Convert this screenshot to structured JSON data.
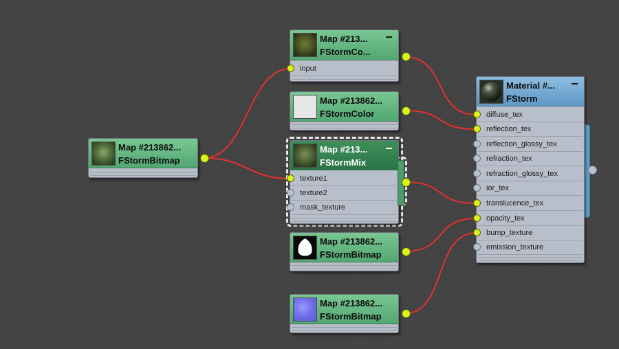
{
  "colors": {
    "canvas": "#434343",
    "wire": "#e53030",
    "connected_port": "#d9f21a",
    "free_port": "#b9c2d3",
    "map_header": "#5fb27e",
    "material_header": "#74a9d4"
  },
  "nodes": {
    "bitmap_source": {
      "line1": "Map #213862...",
      "line2": "FStormBitmap",
      "thumb": "leaf-texture"
    },
    "color_correct": {
      "line1": "Map #213...",
      "line2": "FStormCo...",
      "thumb": "leaf-texture-dark",
      "ports": [
        "input"
      ]
    },
    "fstorm_color": {
      "line1": "Map #213862...",
      "line2": "FStormColor",
      "thumb": "white-swatch"
    },
    "fstorm_mix": {
      "line1": "Map #213...",
      "line2": "FStormMix",
      "thumb": "leaf-texture",
      "ports": [
        "texture1",
        "texture2",
        "mask_texture"
      ]
    },
    "opacity_bitmap": {
      "line1": "Map #213862...",
      "line2": "FStormBitmap",
      "thumb": "leaf-mask"
    },
    "normal_bitmap": {
      "line1": "Map #213862...",
      "line2": "FStormBitmap",
      "thumb": "normal-map"
    },
    "material": {
      "line1": "Material #...",
      "line2": "FStorm",
      "thumb": "material-sphere",
      "ports": [
        "diffuse_tex",
        "reflection_tex",
        "reflection_glossy_tex",
        "refraction_tex",
        "refraction_glossy_tex",
        "ior_tex",
        "translucence_tex",
        "opacity_tex",
        "bump_texture",
        "emission_texture"
      ]
    }
  }
}
